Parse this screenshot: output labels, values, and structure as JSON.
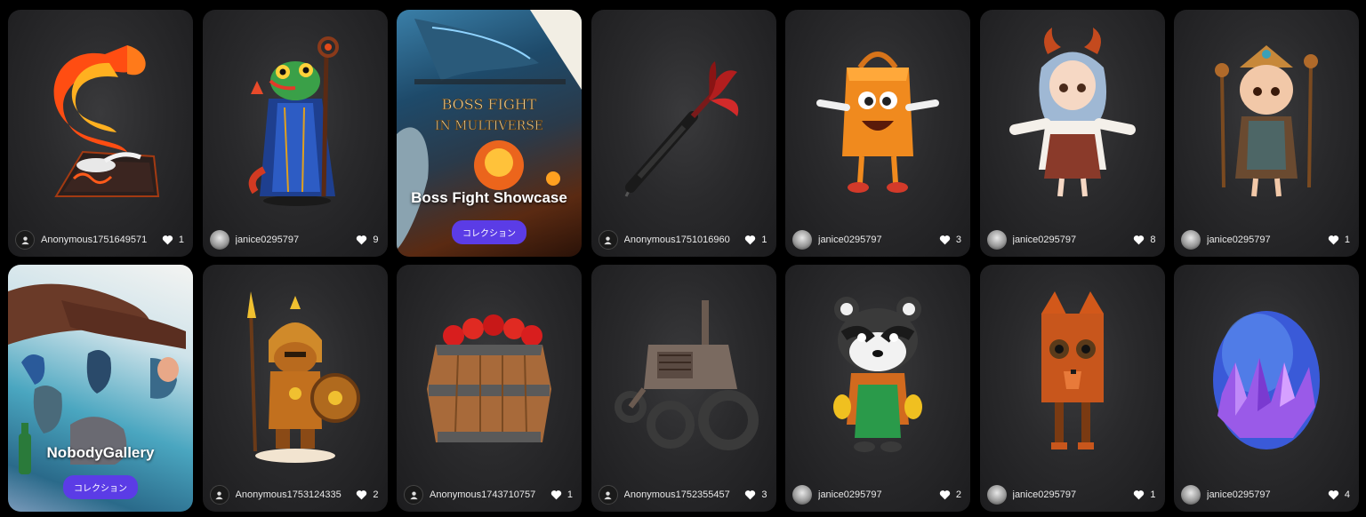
{
  "heart_color": "#ffffff",
  "accent_color": "#5b3ce6",
  "row1": [
    {
      "kind": "model",
      "user": "Anonymous1751649571",
      "avatar": "anonymous",
      "likes": "1",
      "art": "fire-wave-sculpture"
    },
    {
      "kind": "model",
      "user": "janice0295797",
      "avatar": "user",
      "likes": "9",
      "art": "lizard-wizard"
    },
    {
      "kind": "collection",
      "title": "Boss Fight Showcase",
      "button": "コレクション",
      "banner_line1": "BOSS FIGHT",
      "banner_line2": "IN MULTIVERSE"
    },
    {
      "kind": "model",
      "user": "Anonymous1751016960",
      "avatar": "anonymous",
      "likes": "1",
      "art": "dart"
    },
    {
      "kind": "model",
      "user": "janice0295797",
      "avatar": "user",
      "likes": "3",
      "art": "shopping-bag-character"
    },
    {
      "kind": "model",
      "user": "janice0295797",
      "avatar": "user",
      "likes": "8",
      "art": "horned-anime-girl"
    },
    {
      "kind": "model",
      "user": "janice0295797",
      "avatar": "user",
      "likes": "1",
      "art": "monkey-king-figure"
    }
  ],
  "row2": [
    {
      "kind": "collection",
      "title": "NobodyGallery",
      "button": "コレクション"
    },
    {
      "kind": "model",
      "user": "Anonymous1753124335",
      "avatar": "anonymous",
      "likes": "2",
      "art": "knight-with-spear"
    },
    {
      "kind": "model",
      "user": "Anonymous1743710757",
      "avatar": "anonymous",
      "likes": "1",
      "art": "apple-barrel"
    },
    {
      "kind": "model",
      "user": "Anonymous1752355457",
      "avatar": "anonymous",
      "likes": "3",
      "art": "old-tractor"
    },
    {
      "kind": "model",
      "user": "janice0295797",
      "avatar": "user",
      "likes": "2",
      "art": "raccoon-character"
    },
    {
      "kind": "model",
      "user": "janice0295797",
      "avatar": "user",
      "likes": "1",
      "art": "blocky-fox"
    },
    {
      "kind": "model",
      "user": "janice0295797",
      "avatar": "user",
      "likes": "4",
      "art": "crystal-egg"
    }
  ]
}
